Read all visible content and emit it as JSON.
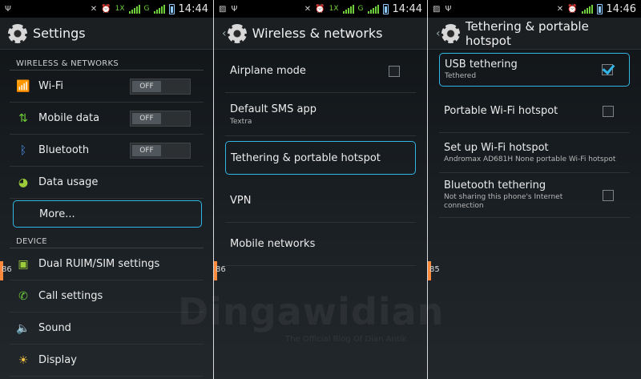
{
  "status": {
    "time1": "14:44",
    "time2": "14:44",
    "time3": "14:46",
    "net1": "1X",
    "net2": "G",
    "net3": "1X",
    "net4": "G"
  },
  "screen1": {
    "title": "Settings",
    "section_wireless": "WIRELESS & NETWORKS",
    "wifi_label": "Wi-Fi",
    "wifi_toggle": "OFF",
    "mobile_data_label": "Mobile data",
    "mobile_data_toggle": "OFF",
    "bluetooth_label": "Bluetooth",
    "bluetooth_toggle": "OFF",
    "data_usage_label": "Data usage",
    "more_label": "More...",
    "section_device": "DEVICE",
    "dual_sim_label": "Dual RUIM/SIM settings",
    "call_settings_label": "Call settings",
    "sound_label": "Sound",
    "display_label": "Display",
    "edge_num": "86"
  },
  "screen2": {
    "title": "Wireless & networks",
    "airplane_label": "Airplane mode",
    "sms_label": "Default SMS app",
    "sms_sub": "Textra",
    "tethering_label": "Tethering & portable hotspot",
    "vpn_label": "VPN",
    "mobile_networks_label": "Mobile networks",
    "edge_num": "86"
  },
  "screen3": {
    "title": "Tethering & portable hotspot",
    "usb_label": "USB tethering",
    "usb_sub": "Tethered",
    "wifi_hotspot_label": "Portable Wi-Fi hotspot",
    "setup_label": "Set up Wi-Fi hotspot",
    "setup_sub": "Andromax AD681H None portable Wi-Fi hotspot",
    "bt_label": "Bluetooth tethering",
    "bt_sub": "Not sharing this phone's Internet connection",
    "edge_num": "85"
  },
  "watermark": {
    "main": "Dingawidian",
    "sub": "The Official Blog Of Dian Antik"
  },
  "colors": {
    "accent": "#33b5e5",
    "edge_tab": "#ff8a3c",
    "signal": "#6fcf3a"
  }
}
